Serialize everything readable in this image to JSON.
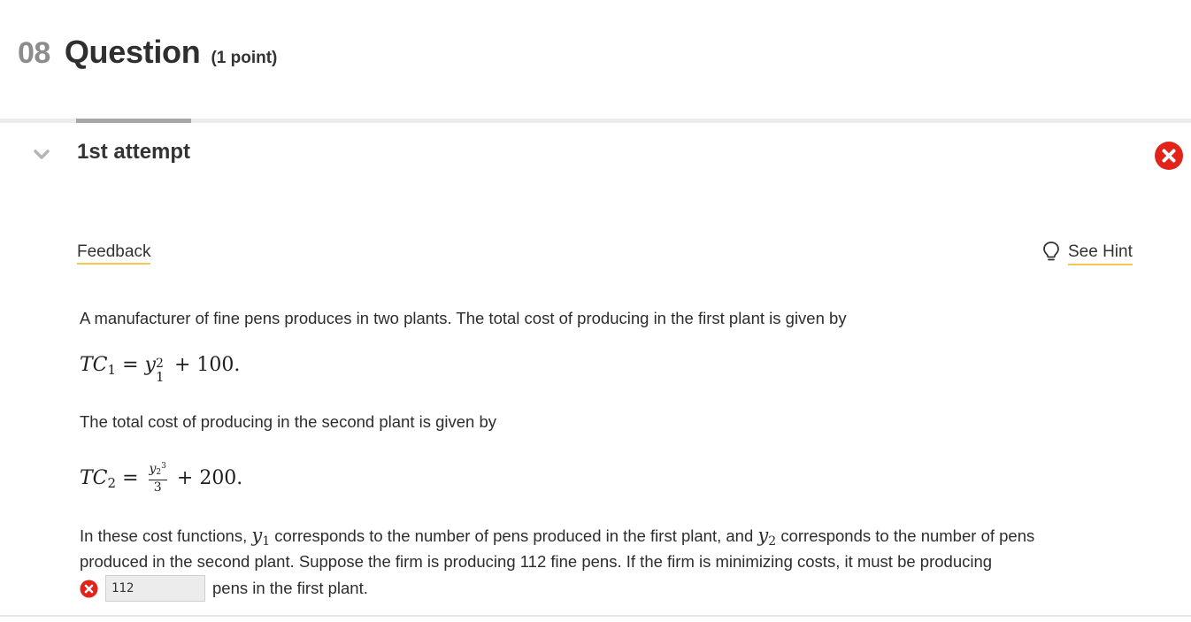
{
  "question": {
    "number": "08",
    "title": "Question",
    "points": "(1 point)"
  },
  "attempt": {
    "label": "1st attempt",
    "status": "incorrect"
  },
  "links": {
    "feedback": "Feedback",
    "hint": "See Hint"
  },
  "body": {
    "intro": "A manufacturer of fine pens produces in two plants. The total cost of producing in the first plant is given by",
    "eq1": {
      "lhs": "TC",
      "lhs_sub": "1",
      "var": "y",
      "var_sub": "1",
      "exp": "2",
      "tail": "+ 100."
    },
    "second": "The total cost of producing in the second plant is given by",
    "eq2": {
      "lhs": "TC",
      "lhs_sub": "2",
      "num_var": "y",
      "num_sub": "2",
      "num_exp": "3",
      "den": "3",
      "tail": "+ 200."
    },
    "p3_a": "In these cost functions,",
    "p3_var1": "y",
    "p3_var1_sub": "1",
    "p3_b": "corresponds to the number of pens produced in the first plant, and",
    "p3_var2": "y",
    "p3_var2_sub": "2",
    "p3_c": "corresponds to the number of pens",
    "p4": "produced in the second plant. Suppose the firm is producing 112 fine pens. If the firm is minimizing costs, it must be producing",
    "answer_value": "112",
    "answer_suffix": "pens in the first plant."
  },
  "colors": {
    "error_red": "#e2231a",
    "hint_underline": "#f2c94c",
    "muted_gray": "#8c8c8c"
  },
  "icons": {
    "attempt_toggle": "chevron-down-icon",
    "attempt_status": "error-x-icon",
    "hint": "lightbulb-icon",
    "answer_status": "error-x-icon"
  }
}
